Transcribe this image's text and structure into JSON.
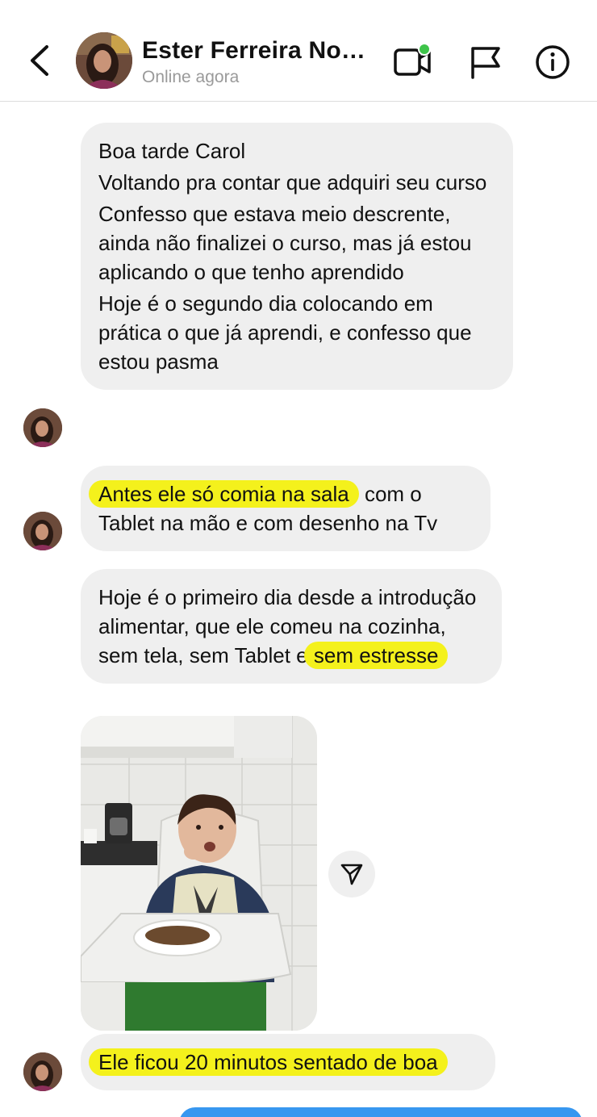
{
  "header": {
    "contact_name": "Ester Ferreira Nog...",
    "status": "Online agora",
    "icons": {
      "back": "chevron-left-icon",
      "video": "video-camera-icon",
      "flag": "flag-icon",
      "info": "info-icon"
    },
    "online_dot_color": "#3ec44a"
  },
  "messages": [
    {
      "paragraphs": [
        "Boa tarde Carol",
        "Voltando pra contar que adquiri seu curso",
        "Confesso que estava meio descrente, ainda não finalizei o curso, mas já estou aplicando o que tenho aprendido",
        "Hoje é o segundo dia colocando em prática o que já aprendi, e confesso que estou pasma"
      ]
    },
    {
      "highlight": "Antes ele só comia na sala",
      "rest": " com o Tablet na mão e com desenho na Tv"
    },
    {
      "text": "Hoje é o primeiro dia desde a introdução alimentar, que ele comeu na cozinha, sem tela, sem Tablet e ",
      "highlight": "sem estresse"
    },
    {
      "highlight": "Ele ficou 20 minutos sentado de boa"
    }
  ],
  "colors": {
    "bubble_bg": "#efefef",
    "highlight": "#f4f11c",
    "outgoing": "#3797f0"
  }
}
